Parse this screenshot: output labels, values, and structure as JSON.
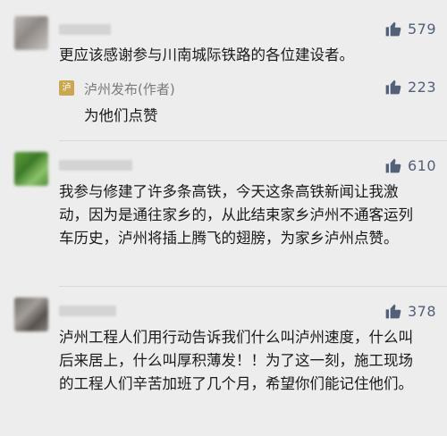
{
  "comments": [
    {
      "likes": "579",
      "text": "更应该感谢参与川南城际铁路的各位建设者。",
      "reply": {
        "author": "泸州发布(作者)",
        "likes": "223",
        "text": "为他们点赞"
      }
    },
    {
      "likes": "610",
      "text": "我参与修建了许多条高铁，今天这条高铁新闻让我激动，因为是通往家乡的，从此结束家乡泸州不通客运列车历史，泸州将插上腾飞的翅膀，为家乡泸州点赞。"
    },
    {
      "likes": "378",
      "text": "泸州工程人们用行动告诉我们什么叫泸州速度，什么叫后来居上，什么叫厚积薄发！！为了这一刻，施工现场的工程人们辛苦加班了几个月，希望你们能记住他们。"
    }
  ],
  "colors": {
    "background": "#ededed",
    "like_color": "#52607a",
    "text_color": "#191919",
    "author_color": "#7a7a7a"
  },
  "icons": {
    "like": "thumbs-up-icon",
    "author_badge": "news-logo-icon"
  }
}
